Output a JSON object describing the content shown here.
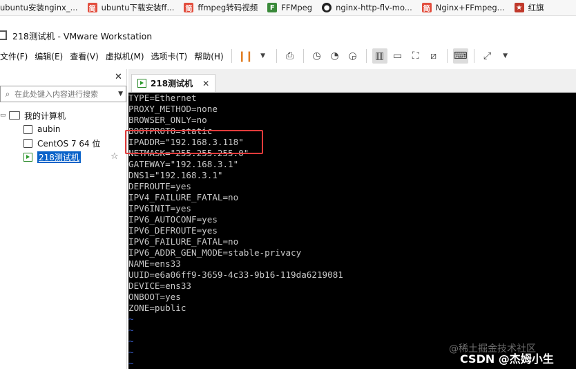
{
  "bookmarks": [
    {
      "label": "ubuntu安装nginx_...",
      "icon": "bookmark-icon"
    },
    {
      "label": "ubuntu下载安装ff...",
      "icon": "bookmark-icon"
    },
    {
      "label": "ffmpeg转码视频",
      "icon": "bookmark-icon"
    },
    {
      "label": "FFMpeg",
      "icon": "bookmark-icon"
    },
    {
      "label": "nginx-http-flv-mo...",
      "icon": "github-icon"
    },
    {
      "label": "Nginx+FFmpeg...",
      "icon": "bookmark-icon"
    },
    {
      "label": "红旗",
      "icon": "bookmark-icon"
    }
  ],
  "window": {
    "title": "218测试机 - VMware Workstation"
  },
  "menu": [
    "文件(F)",
    "编辑(E)",
    "查看(V)",
    "虚拟机(M)",
    "选项卡(T)",
    "帮助(H)"
  ],
  "library": {
    "search_placeholder": "在此处键入内容进行搜索",
    "root": "我的计算机",
    "vms": [
      "aubin",
      "CentOS 7 64 位",
      "218测试机"
    ]
  },
  "tab": {
    "label": "218测试机"
  },
  "console": {
    "lines": [
      "TYPE=Ethernet",
      "PROXY_METHOD=none",
      "BROWSER_ONLY=no",
      "BOOTPROTO=static",
      "IPADDR=\"192.168.3.118\"",
      "NETMASK=\"255.255.255.0\"",
      "GATEWAY=\"192.168.3.1\"",
      "DNS1=\"192.168.3.1\"",
      "DEFROUTE=yes",
      "IPV4_FAILURE_FATAL=no",
      "IPV6INIT=yes",
      "IPV6_AUTOCONF=yes",
      "IPV6_DEFROUTE=yes",
      "IPV6_FAILURE_FATAL=no",
      "IPV6_ADDR_GEN_MODE=stable-privacy",
      "NAME=ens33",
      "UUID=e6a06ff9-3659-4c33-9b16-119da6219081",
      "DEVICE=ens33",
      "ONBOOT=yes",
      "ZONE=public",
      "~",
      "~",
      "~",
      "~",
      "~"
    ]
  },
  "watermark": {
    "line1": "@稀土掘金技术社区",
    "line2": "CSDN @杰姆小生"
  },
  "colors": {
    "highlight": "#e23b3b",
    "selection": "#0a63c9",
    "console_bg": "#000000",
    "pause": "#e07b1f"
  }
}
